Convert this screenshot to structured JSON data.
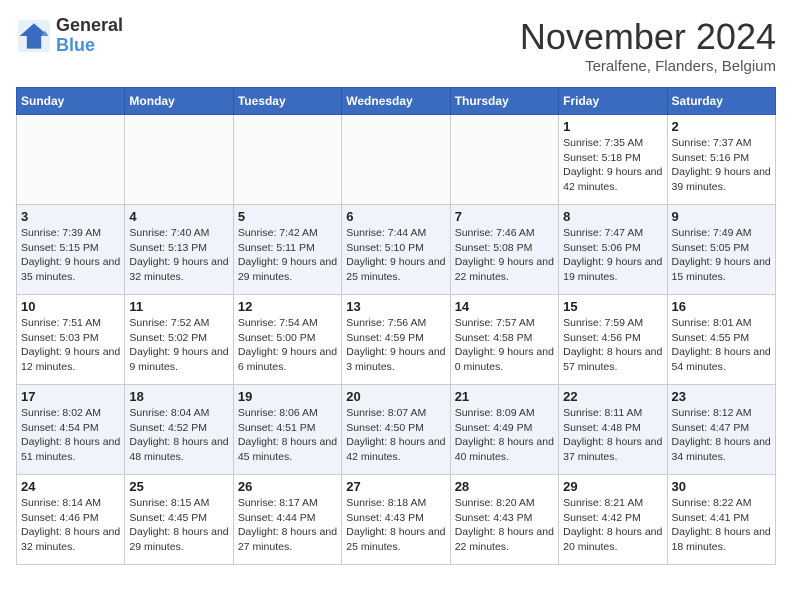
{
  "header": {
    "logo_line1": "General",
    "logo_line2": "Blue",
    "month": "November 2024",
    "location": "Teralfene, Flanders, Belgium"
  },
  "days_of_week": [
    "Sunday",
    "Monday",
    "Tuesday",
    "Wednesday",
    "Thursday",
    "Friday",
    "Saturday"
  ],
  "weeks": [
    [
      {
        "day": "",
        "info": ""
      },
      {
        "day": "",
        "info": ""
      },
      {
        "day": "",
        "info": ""
      },
      {
        "day": "",
        "info": ""
      },
      {
        "day": "",
        "info": ""
      },
      {
        "day": "1",
        "info": "Sunrise: 7:35 AM\nSunset: 5:18 PM\nDaylight: 9 hours and 42 minutes."
      },
      {
        "day": "2",
        "info": "Sunrise: 7:37 AM\nSunset: 5:16 PM\nDaylight: 9 hours and 39 minutes."
      }
    ],
    [
      {
        "day": "3",
        "info": "Sunrise: 7:39 AM\nSunset: 5:15 PM\nDaylight: 9 hours and 35 minutes."
      },
      {
        "day": "4",
        "info": "Sunrise: 7:40 AM\nSunset: 5:13 PM\nDaylight: 9 hours and 32 minutes."
      },
      {
        "day": "5",
        "info": "Sunrise: 7:42 AM\nSunset: 5:11 PM\nDaylight: 9 hours and 29 minutes."
      },
      {
        "day": "6",
        "info": "Sunrise: 7:44 AM\nSunset: 5:10 PM\nDaylight: 9 hours and 25 minutes."
      },
      {
        "day": "7",
        "info": "Sunrise: 7:46 AM\nSunset: 5:08 PM\nDaylight: 9 hours and 22 minutes."
      },
      {
        "day": "8",
        "info": "Sunrise: 7:47 AM\nSunset: 5:06 PM\nDaylight: 9 hours and 19 minutes."
      },
      {
        "day": "9",
        "info": "Sunrise: 7:49 AM\nSunset: 5:05 PM\nDaylight: 9 hours and 15 minutes."
      }
    ],
    [
      {
        "day": "10",
        "info": "Sunrise: 7:51 AM\nSunset: 5:03 PM\nDaylight: 9 hours and 12 minutes."
      },
      {
        "day": "11",
        "info": "Sunrise: 7:52 AM\nSunset: 5:02 PM\nDaylight: 9 hours and 9 minutes."
      },
      {
        "day": "12",
        "info": "Sunrise: 7:54 AM\nSunset: 5:00 PM\nDaylight: 9 hours and 6 minutes."
      },
      {
        "day": "13",
        "info": "Sunrise: 7:56 AM\nSunset: 4:59 PM\nDaylight: 9 hours and 3 minutes."
      },
      {
        "day": "14",
        "info": "Sunrise: 7:57 AM\nSunset: 4:58 PM\nDaylight: 9 hours and 0 minutes."
      },
      {
        "day": "15",
        "info": "Sunrise: 7:59 AM\nSunset: 4:56 PM\nDaylight: 8 hours and 57 minutes."
      },
      {
        "day": "16",
        "info": "Sunrise: 8:01 AM\nSunset: 4:55 PM\nDaylight: 8 hours and 54 minutes."
      }
    ],
    [
      {
        "day": "17",
        "info": "Sunrise: 8:02 AM\nSunset: 4:54 PM\nDaylight: 8 hours and 51 minutes."
      },
      {
        "day": "18",
        "info": "Sunrise: 8:04 AM\nSunset: 4:52 PM\nDaylight: 8 hours and 48 minutes."
      },
      {
        "day": "19",
        "info": "Sunrise: 8:06 AM\nSunset: 4:51 PM\nDaylight: 8 hours and 45 minutes."
      },
      {
        "day": "20",
        "info": "Sunrise: 8:07 AM\nSunset: 4:50 PM\nDaylight: 8 hours and 42 minutes."
      },
      {
        "day": "21",
        "info": "Sunrise: 8:09 AM\nSunset: 4:49 PM\nDaylight: 8 hours and 40 minutes."
      },
      {
        "day": "22",
        "info": "Sunrise: 8:11 AM\nSunset: 4:48 PM\nDaylight: 8 hours and 37 minutes."
      },
      {
        "day": "23",
        "info": "Sunrise: 8:12 AM\nSunset: 4:47 PM\nDaylight: 8 hours and 34 minutes."
      }
    ],
    [
      {
        "day": "24",
        "info": "Sunrise: 8:14 AM\nSunset: 4:46 PM\nDaylight: 8 hours and 32 minutes."
      },
      {
        "day": "25",
        "info": "Sunrise: 8:15 AM\nSunset: 4:45 PM\nDaylight: 8 hours and 29 minutes."
      },
      {
        "day": "26",
        "info": "Sunrise: 8:17 AM\nSunset: 4:44 PM\nDaylight: 8 hours and 27 minutes."
      },
      {
        "day": "27",
        "info": "Sunrise: 8:18 AM\nSunset: 4:43 PM\nDaylight: 8 hours and 25 minutes."
      },
      {
        "day": "28",
        "info": "Sunrise: 8:20 AM\nSunset: 4:43 PM\nDaylight: 8 hours and 22 minutes."
      },
      {
        "day": "29",
        "info": "Sunrise: 8:21 AM\nSunset: 4:42 PM\nDaylight: 8 hours and 20 minutes."
      },
      {
        "day": "30",
        "info": "Sunrise: 8:22 AM\nSunset: 4:41 PM\nDaylight: 8 hours and 18 minutes."
      }
    ]
  ]
}
